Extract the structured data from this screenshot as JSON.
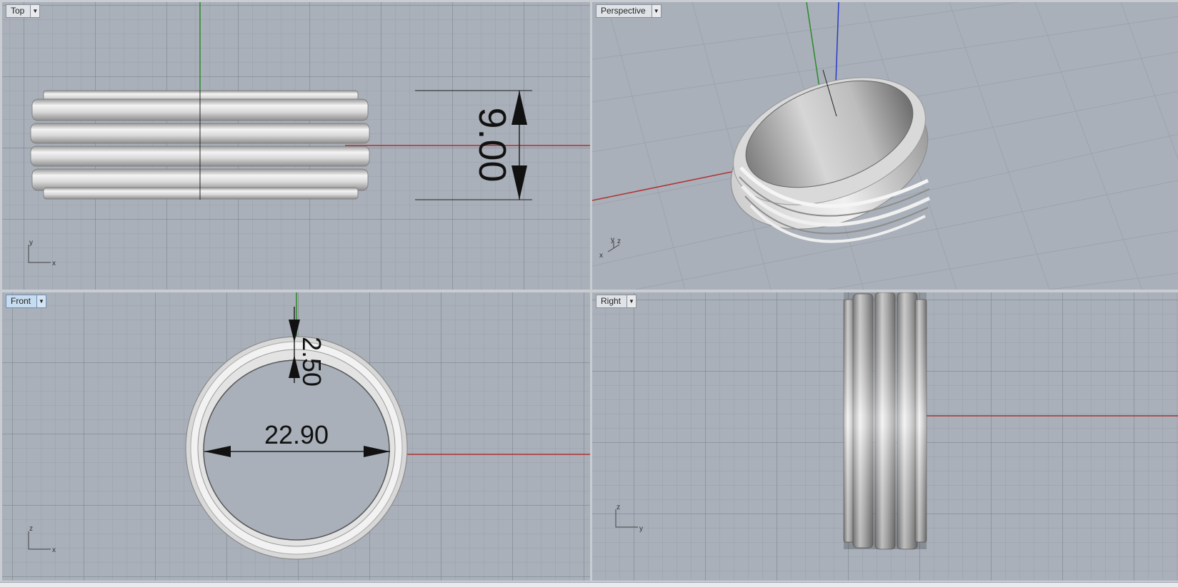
{
  "viewports": {
    "top": {
      "label": "Top",
      "dimension": "9.00",
      "axes": {
        "vertical": "y",
        "horizontal": "x"
      }
    },
    "perspective": {
      "label": "Perspective",
      "axes": {
        "a": "y",
        "b": "z",
        "c": "x"
      }
    },
    "front": {
      "label": "Front",
      "dim_thickness": "2.50",
      "dim_diameter": "22.90",
      "axes": {
        "vertical": "z",
        "horizontal": "x"
      }
    },
    "right": {
      "label": "Right",
      "axes": {
        "vertical": "z",
        "horizontal": "y"
      }
    }
  },
  "colors": {
    "viewport_bg": "#a9b0b9",
    "x_axis": "#b03030",
    "y_axis": "#2a8a2a",
    "z_axis": "#2a3ac8",
    "active_tab": "#c8dcf0",
    "metal_light": "#f2f2f2",
    "metal_dark": "#8c8c8c"
  },
  "icons": {
    "dropdown": "chevron-down-icon"
  }
}
